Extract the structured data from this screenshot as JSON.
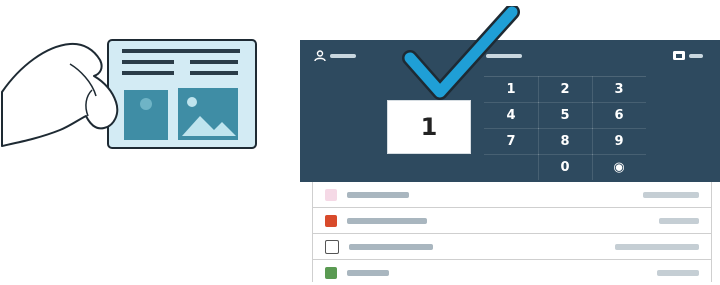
{
  "keypad": {
    "display_value": "1",
    "keys": [
      {
        "label": "1"
      },
      {
        "label": "2"
      },
      {
        "label": "3"
      },
      {
        "label": "4"
      },
      {
        "label": "5"
      },
      {
        "label": "6"
      },
      {
        "label": "7"
      },
      {
        "label": "8"
      },
      {
        "label": "9"
      },
      {
        "label": ""
      },
      {
        "label": "0"
      },
      {
        "label": "◉"
      }
    ]
  },
  "icons": {
    "user": "user-icon",
    "check": "checkmark-icon",
    "settings": "printer-icon"
  },
  "colors": {
    "panel": "#2e4a5f",
    "check": "#1f9fd6",
    "card": "#d3ebf4"
  },
  "list": {
    "rows": [
      {
        "icon": "photo-icon"
      },
      {
        "icon": "shield-icon"
      },
      {
        "icon": "archive-icon"
      },
      {
        "icon": "tree-icon"
      }
    ]
  }
}
